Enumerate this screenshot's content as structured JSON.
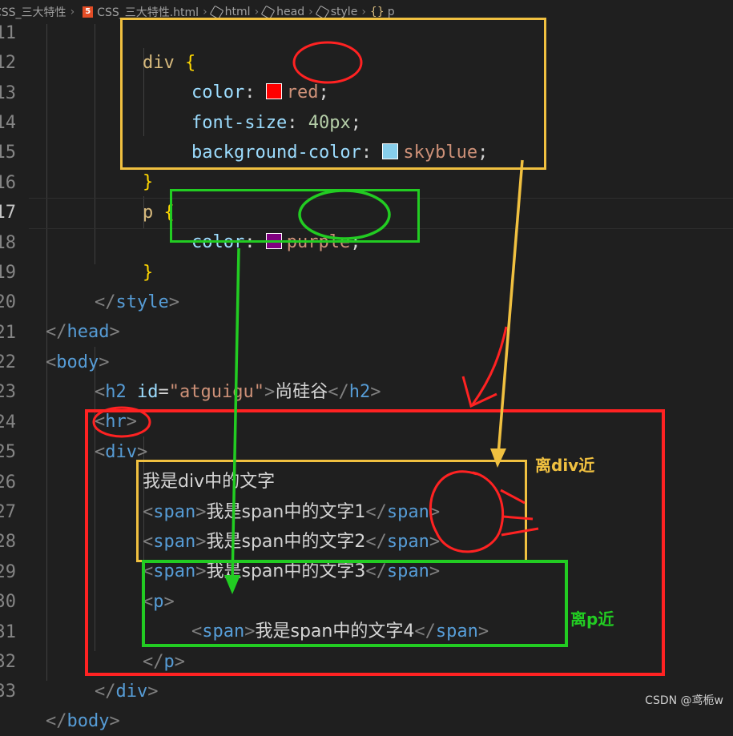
{
  "breadcrumb": {
    "folder": "CSS_三大特性",
    "file": "CSS_三大特性.html",
    "items": [
      "html",
      "head",
      "style",
      "p"
    ]
  },
  "lines": [
    {
      "n": "11"
    },
    {
      "n": "12"
    },
    {
      "n": "13"
    },
    {
      "n": "14"
    },
    {
      "n": "15"
    },
    {
      "n": "16"
    },
    {
      "n": "17"
    },
    {
      "n": "18"
    },
    {
      "n": "19"
    },
    {
      "n": "20"
    },
    {
      "n": "21"
    },
    {
      "n": "22"
    },
    {
      "n": "23"
    },
    {
      "n": "24"
    },
    {
      "n": "25"
    },
    {
      "n": "26"
    },
    {
      "n": "27"
    },
    {
      "n": "28"
    },
    {
      "n": "29"
    },
    {
      "n": "30"
    },
    {
      "n": "31"
    },
    {
      "n": "32"
    },
    {
      "n": "33"
    }
  ],
  "code": {
    "div_selector": "div",
    "open_brace": "{",
    "close_brace": "}",
    "color_prop": "color",
    "red": "red",
    "font_size_prop": "font-size",
    "font_size_val": "40px",
    "bg_prop": "background-color",
    "skyblue": "skyblue",
    "p_selector": "p",
    "purple": "purple",
    "style": "style",
    "head": "head",
    "body": "body",
    "h2": "h2",
    "id_attr": "id",
    "id_val": "\"atguigu\"",
    "h2_text": "尚硅谷",
    "hr": "hr",
    "div": "div",
    "div_text": "我是div中的文字",
    "span": "span",
    "span1": "我是span中的文字1",
    "span2": "我是span中的文字2",
    "span3": "我是span中的文字3",
    "span4": "我是span中的文字4",
    "p": "p"
  },
  "annotations": {
    "near_div": "离div近",
    "near_p": "离p近"
  },
  "watermark": "CSDN @鸢栀w",
  "colors": {
    "red_swatch": "#ff0000",
    "skyblue_swatch": "#87ceeb",
    "purple_swatch": "#800080",
    "box_yellow": "#f0c040",
    "box_green": "#22cc22",
    "box_red": "#ff2222"
  }
}
